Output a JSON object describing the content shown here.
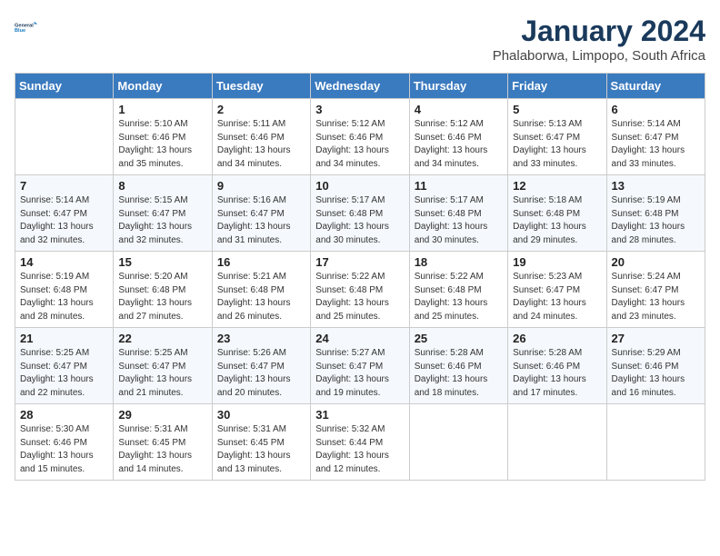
{
  "logo": {
    "line1": "General",
    "line2": "Blue"
  },
  "title": "January 2024",
  "subtitle": "Phalaborwa, Limpopo, South Africa",
  "days_of_week": [
    "Sunday",
    "Monday",
    "Tuesday",
    "Wednesday",
    "Thursday",
    "Friday",
    "Saturday"
  ],
  "weeks": [
    [
      {
        "day": "",
        "info": ""
      },
      {
        "day": "1",
        "info": "Sunrise: 5:10 AM\nSunset: 6:46 PM\nDaylight: 13 hours\nand 35 minutes."
      },
      {
        "day": "2",
        "info": "Sunrise: 5:11 AM\nSunset: 6:46 PM\nDaylight: 13 hours\nand 34 minutes."
      },
      {
        "day": "3",
        "info": "Sunrise: 5:12 AM\nSunset: 6:46 PM\nDaylight: 13 hours\nand 34 minutes."
      },
      {
        "day": "4",
        "info": "Sunrise: 5:12 AM\nSunset: 6:46 PM\nDaylight: 13 hours\nand 34 minutes."
      },
      {
        "day": "5",
        "info": "Sunrise: 5:13 AM\nSunset: 6:47 PM\nDaylight: 13 hours\nand 33 minutes."
      },
      {
        "day": "6",
        "info": "Sunrise: 5:14 AM\nSunset: 6:47 PM\nDaylight: 13 hours\nand 33 minutes."
      }
    ],
    [
      {
        "day": "7",
        "info": "Sunrise: 5:14 AM\nSunset: 6:47 PM\nDaylight: 13 hours\nand 32 minutes."
      },
      {
        "day": "8",
        "info": "Sunrise: 5:15 AM\nSunset: 6:47 PM\nDaylight: 13 hours\nand 32 minutes."
      },
      {
        "day": "9",
        "info": "Sunrise: 5:16 AM\nSunset: 6:47 PM\nDaylight: 13 hours\nand 31 minutes."
      },
      {
        "day": "10",
        "info": "Sunrise: 5:17 AM\nSunset: 6:48 PM\nDaylight: 13 hours\nand 30 minutes."
      },
      {
        "day": "11",
        "info": "Sunrise: 5:17 AM\nSunset: 6:48 PM\nDaylight: 13 hours\nand 30 minutes."
      },
      {
        "day": "12",
        "info": "Sunrise: 5:18 AM\nSunset: 6:48 PM\nDaylight: 13 hours\nand 29 minutes."
      },
      {
        "day": "13",
        "info": "Sunrise: 5:19 AM\nSunset: 6:48 PM\nDaylight: 13 hours\nand 28 minutes."
      }
    ],
    [
      {
        "day": "14",
        "info": "Sunrise: 5:19 AM\nSunset: 6:48 PM\nDaylight: 13 hours\nand 28 minutes."
      },
      {
        "day": "15",
        "info": "Sunrise: 5:20 AM\nSunset: 6:48 PM\nDaylight: 13 hours\nand 27 minutes."
      },
      {
        "day": "16",
        "info": "Sunrise: 5:21 AM\nSunset: 6:48 PM\nDaylight: 13 hours\nand 26 minutes."
      },
      {
        "day": "17",
        "info": "Sunrise: 5:22 AM\nSunset: 6:48 PM\nDaylight: 13 hours\nand 25 minutes."
      },
      {
        "day": "18",
        "info": "Sunrise: 5:22 AM\nSunset: 6:48 PM\nDaylight: 13 hours\nand 25 minutes."
      },
      {
        "day": "19",
        "info": "Sunrise: 5:23 AM\nSunset: 6:47 PM\nDaylight: 13 hours\nand 24 minutes."
      },
      {
        "day": "20",
        "info": "Sunrise: 5:24 AM\nSunset: 6:47 PM\nDaylight: 13 hours\nand 23 minutes."
      }
    ],
    [
      {
        "day": "21",
        "info": "Sunrise: 5:25 AM\nSunset: 6:47 PM\nDaylight: 13 hours\nand 22 minutes."
      },
      {
        "day": "22",
        "info": "Sunrise: 5:25 AM\nSunset: 6:47 PM\nDaylight: 13 hours\nand 21 minutes."
      },
      {
        "day": "23",
        "info": "Sunrise: 5:26 AM\nSunset: 6:47 PM\nDaylight: 13 hours\nand 20 minutes."
      },
      {
        "day": "24",
        "info": "Sunrise: 5:27 AM\nSunset: 6:47 PM\nDaylight: 13 hours\nand 19 minutes."
      },
      {
        "day": "25",
        "info": "Sunrise: 5:28 AM\nSunset: 6:46 PM\nDaylight: 13 hours\nand 18 minutes."
      },
      {
        "day": "26",
        "info": "Sunrise: 5:28 AM\nSunset: 6:46 PM\nDaylight: 13 hours\nand 17 minutes."
      },
      {
        "day": "27",
        "info": "Sunrise: 5:29 AM\nSunset: 6:46 PM\nDaylight: 13 hours\nand 16 minutes."
      }
    ],
    [
      {
        "day": "28",
        "info": "Sunrise: 5:30 AM\nSunset: 6:46 PM\nDaylight: 13 hours\nand 15 minutes."
      },
      {
        "day": "29",
        "info": "Sunrise: 5:31 AM\nSunset: 6:45 PM\nDaylight: 13 hours\nand 14 minutes."
      },
      {
        "day": "30",
        "info": "Sunrise: 5:31 AM\nSunset: 6:45 PM\nDaylight: 13 hours\nand 13 minutes."
      },
      {
        "day": "31",
        "info": "Sunrise: 5:32 AM\nSunset: 6:44 PM\nDaylight: 13 hours\nand 12 minutes."
      },
      {
        "day": "",
        "info": ""
      },
      {
        "day": "",
        "info": ""
      },
      {
        "day": "",
        "info": ""
      }
    ]
  ]
}
